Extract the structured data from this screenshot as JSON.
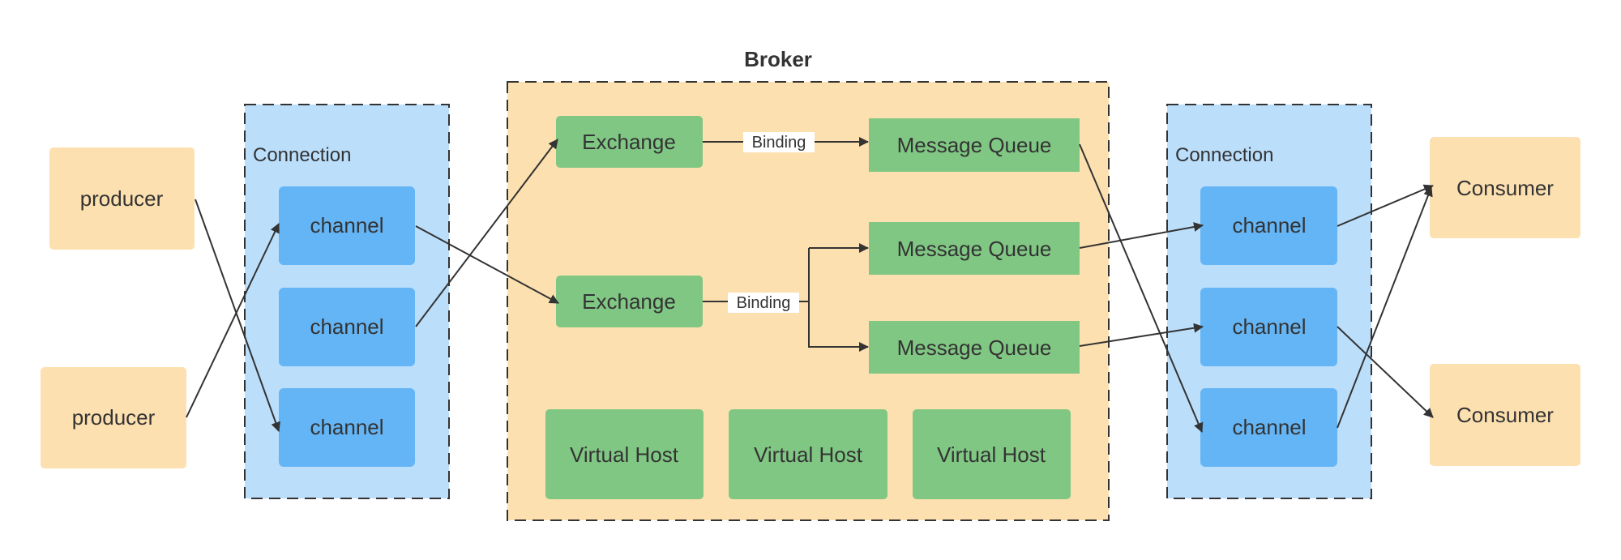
{
  "colors": {
    "peach": "#fde0b0",
    "connection_bg": "#bbdefb",
    "channel": "#64b5f6",
    "green": "#81c784",
    "line": "#333333"
  },
  "broker": {
    "title": "Broker"
  },
  "producers": [
    "producer",
    "producer"
  ],
  "left_connection": {
    "label": "Connection",
    "channels": [
      "channel",
      "channel",
      "channel"
    ]
  },
  "exchanges": [
    "Exchange",
    "Exchange"
  ],
  "bindings": [
    "Binding",
    "Binding"
  ],
  "queues": [
    "Message Queue",
    "Message Queue",
    "Message Queue"
  ],
  "virtual_hosts": [
    "Virtual Host",
    "Virtual Host",
    "Virtual Host"
  ],
  "right_connection": {
    "label": "Connection",
    "channels": [
      "channel",
      "channel",
      "channel"
    ]
  },
  "consumers": [
    "Consumer",
    "Consumer"
  ]
}
